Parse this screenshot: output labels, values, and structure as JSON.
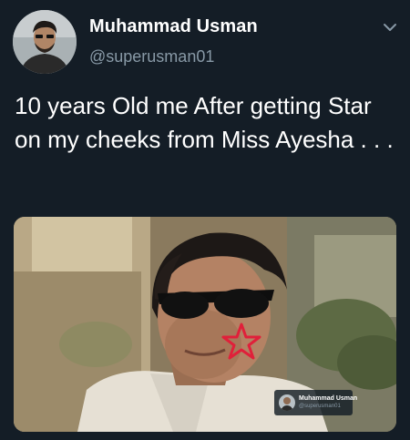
{
  "author": {
    "name": "Muhammad Usman",
    "handle": "@superusman01"
  },
  "tweet": {
    "text": "10 years Old me After getting Star on my cheeks from Miss Ayesha . . ."
  },
  "media": {
    "watermark_name": "Muhammad Usman",
    "watermark_handle": "@superusman01"
  },
  "icons": {
    "menu": "chevron-down-icon"
  },
  "colors": {
    "background": "#141d26",
    "secondary_text": "#8899a6",
    "star": "#e0203a"
  }
}
